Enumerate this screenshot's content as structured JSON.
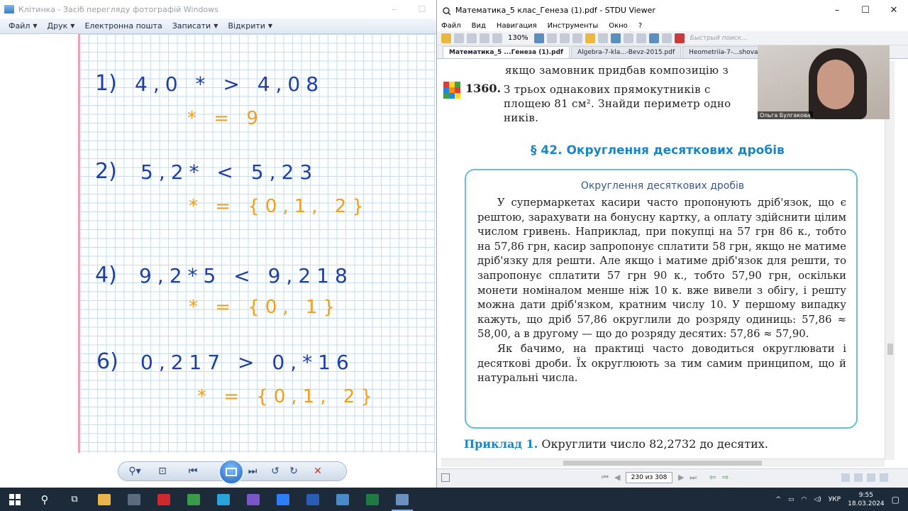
{
  "photo_viewer": {
    "title": "Клітинка - Засіб перегляду фотографій Windows",
    "menu": [
      "Файл",
      "Друк",
      "Електронна пошта",
      "Записати",
      "Відкрити"
    ],
    "note": {
      "rows": [
        {
          "num": "1)",
          "expr": "4,0 * > 4,08",
          "answer": "* = 9"
        },
        {
          "num": "2)",
          "expr": "5,2* < 5,23",
          "answer": "* = {0,1, 2}"
        },
        {
          "num": "4)",
          "expr": "9,2*5 < 9,218",
          "answer": "* = {0, 1}"
        },
        {
          "num": "6)",
          "expr": "0,217 > 0,*16",
          "answer": "* = {0,1, 2}"
        }
      ]
    },
    "controls": [
      "zoom-icon",
      "fit-icon",
      "previous-icon",
      "slideshow-icon",
      "next-icon",
      "rotate-left-icon",
      "rotate-right-icon",
      "delete-icon"
    ]
  },
  "stdu": {
    "title": "Математика_5 клас_Генеза (1).pdf - STDU Viewer",
    "menu": [
      "Файл",
      "Вид",
      "Навигация",
      "Инструменты",
      "Окно",
      "?"
    ],
    "zoom": "130%",
    "search_placeholder": "Быстрый поиск...",
    "tabs": [
      "Математика_5 ...Генеза (1).pdf",
      "Algebra-7-kla...-Bevz-2015.pdf",
      "Heometriia-7-...shova-2015.pdf"
    ],
    "page": {
      "prev_line": "якщо замовник придбав композицію з",
      "ex_number": "1360.",
      "ex_lines": [
        "З трьох однакових прямокутників с",
        "площею 81 см². Знайди периметр одно",
        "ників."
      ],
      "section_heading": "§ 42. Округлення десяткових дробів",
      "box_title": "Округлення десяткових дробів",
      "box_p1": "У супермаркетах касири часто пропонують дріб'язок, що є рештою, зарахувати на бонусну картку, а оплату здійснити цілим числом гривень. Наприклад, при покупці на 57 грн 86 к., тобто на 57,86 грн, касир запропонує сплатити 58 грн, якщо не матиме дріб'язку для решти. Але якщо і матиме дріб'язок для решти, то запропонує сплатити 57 грн 90 к., тобто 57,90 грн, оскільки монети номіналом менше ніж 10 к. вже вивели з обігу, і решту можна дати дріб'язком, кратним числу 10. У першому випадку кажуть, що дріб 57,86 округлили до розряду одиниць: 57,86 ≈ 58,00, а в другому — що до розряду десятих: 57,86 ≈ 57,90.",
      "box_p2": "Як бачимо, на практиці часто доводиться округлювати і десяткові дроби. Їх округлюють за тим самим принципом, що й натуральні числа.",
      "example_label": "Приклад 1.",
      "example_text": "Округлити число 82,2732 до десятих."
    },
    "page_indicator": "230 из 308"
  },
  "webcam": {
    "name": "Ольга Булгакова"
  },
  "taskbar": {
    "lang": "УКР",
    "time": "9:55",
    "date": "18.03.2024",
    "apps": [
      {
        "name": "file-explorer-icon",
        "color": "#e8b64a"
      },
      {
        "name": "calculator-icon",
        "color": "#5b6c80"
      },
      {
        "name": "opera-icon",
        "color": "#d0282f"
      },
      {
        "name": "chrome-icon",
        "color": "#3a9a4a"
      },
      {
        "name": "telegram-icon",
        "color": "#2aa3d8"
      },
      {
        "name": "viber-icon",
        "color": "#7c55c8"
      },
      {
        "name": "zoom-app-icon",
        "color": "#2d7ff9"
      },
      {
        "name": "word-icon",
        "color": "#2b5cb8"
      },
      {
        "name": "photos-icon",
        "color": "#4a8ac8"
      },
      {
        "name": "excel-icon",
        "color": "#1f7a44"
      },
      {
        "name": "stdu-viewer-icon",
        "color": "#6a8fc0"
      }
    ]
  }
}
